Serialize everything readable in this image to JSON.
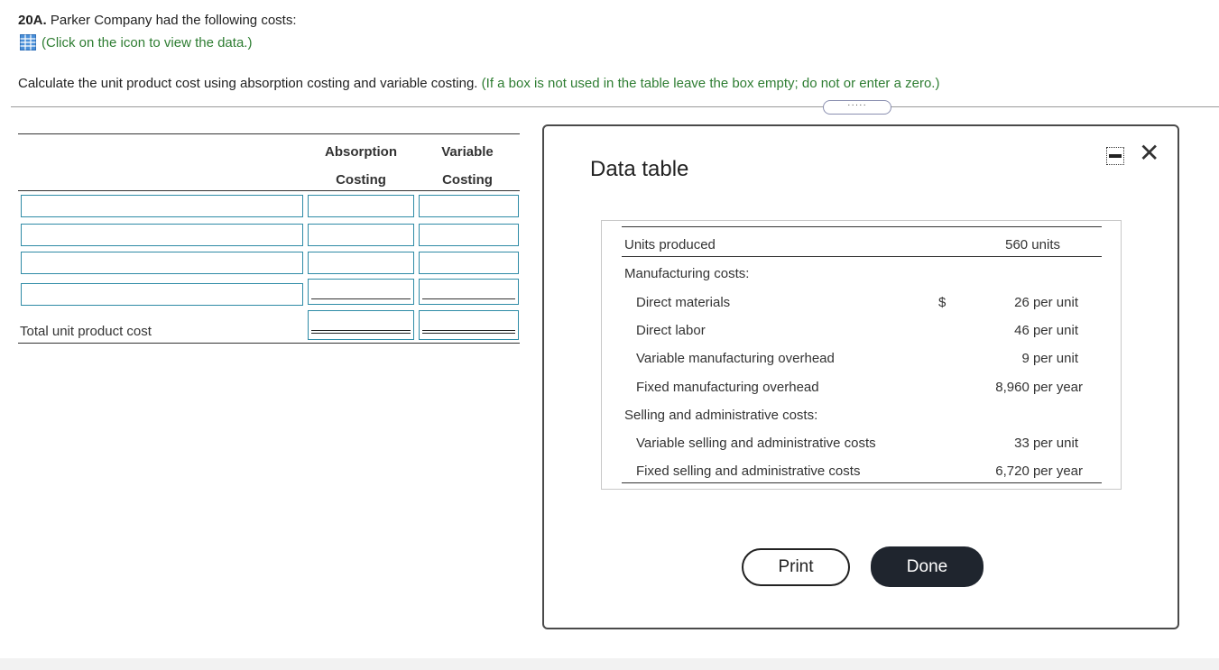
{
  "question": {
    "number": "20A.",
    "text": " Parker Company had the following costs:",
    "icon_link": "(Click on the icon to view the data.)",
    "instruction": "Calculate the unit product cost using absorption costing and variable costing.",
    "instruction_note": "(If a box is not used in the table leave the box empty; do not or enter a zero.)",
    "expander": "·····"
  },
  "answer_table": {
    "col1_line1": "Absorption",
    "col1_line2": "Costing",
    "col2_line1": "Variable",
    "col2_line2": "Costing",
    "total_label": "Total unit product cost"
  },
  "modal": {
    "title": "Data table",
    "rows": {
      "units_label": "Units produced",
      "units_value": "560 units",
      "mfg_header": "Manufacturing costs:",
      "dm_label": "Direct materials",
      "dm_dollar": "$",
      "dm_value": "26 per unit",
      "dl_label": "Direct labor",
      "dl_value": "46 per unit",
      "vmo_label": "Variable manufacturing overhead",
      "vmo_value": "9 per unit",
      "fmo_label": "Fixed manufacturing overhead",
      "fmo_value": "8,960 per year",
      "sa_header": "Selling and administrative costs:",
      "vsa_label": "Variable selling and administrative costs",
      "vsa_value": "33 per unit",
      "fsa_label": "Fixed selling and administrative costs",
      "fsa_value": "6,720 per year"
    },
    "print_label": "Print",
    "done_label": "Done",
    "close_glyph": "✕"
  },
  "icons": {
    "grid": "grid-table-icon",
    "minimize": "minimize-icon",
    "close": "close-icon"
  },
  "colors": {
    "accent_green": "#2e7d32",
    "input_border": "#2e8ba6",
    "done_button": "#1f252e"
  }
}
